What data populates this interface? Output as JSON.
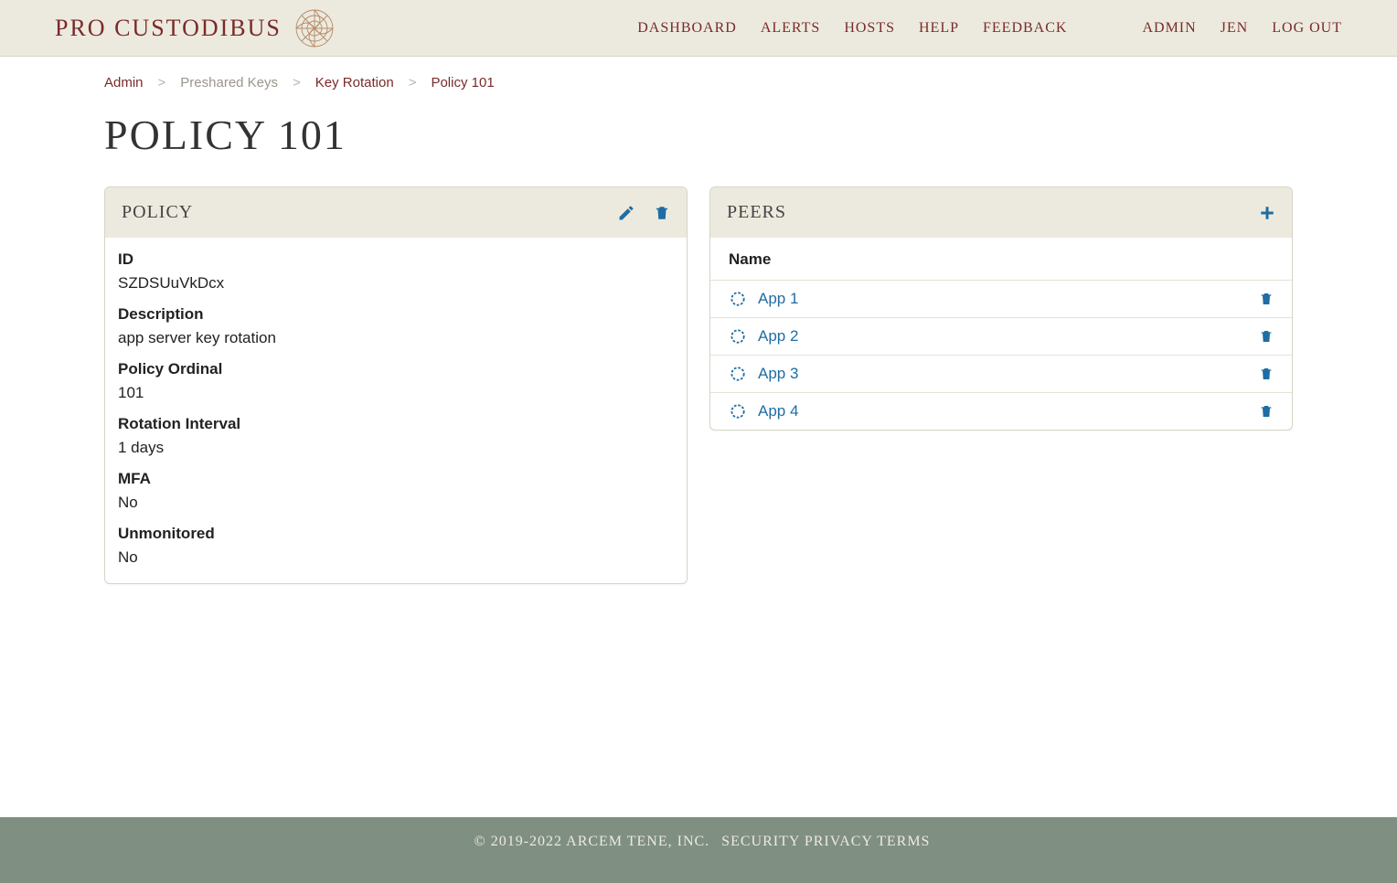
{
  "brand": {
    "name": "PRO CUSTODIBUS"
  },
  "nav": {
    "main": [
      "DASHBOARD",
      "ALERTS",
      "HOSTS",
      "HELP",
      "FEEDBACK"
    ],
    "user": [
      "ADMIN",
      "JEN",
      "LOG OUT"
    ]
  },
  "breadcrumb": {
    "items": [
      {
        "label": "Admin",
        "link": true
      },
      {
        "label": "Preshared Keys",
        "link": false
      },
      {
        "label": "Key Rotation",
        "link": true
      },
      {
        "label": "Policy 101",
        "current": true
      }
    ]
  },
  "page": {
    "title": "POLICY 101"
  },
  "policy_panel": {
    "title": "POLICY",
    "fields": {
      "id_label": "ID",
      "id_value": "SZDSUuVkDcx",
      "description_label": "Description",
      "description_value": "app server key rotation",
      "ordinal_label": "Policy Ordinal",
      "ordinal_value": "101",
      "interval_label": "Rotation Interval",
      "interval_value": "1 days",
      "mfa_label": "MFA",
      "mfa_value": "No",
      "unmonitored_label": "Unmonitored",
      "unmonitored_value": "No"
    }
  },
  "peers_panel": {
    "title": "PEERS",
    "column": "Name",
    "rows": [
      {
        "name": "App 1"
      },
      {
        "name": "App 2"
      },
      {
        "name": "App 3"
      },
      {
        "name": "App 4"
      }
    ]
  },
  "footer": {
    "copyright": "© 2019-2022 ARCEM TENE, INC.",
    "links": [
      "SECURITY",
      "PRIVACY",
      "TERMS"
    ]
  }
}
